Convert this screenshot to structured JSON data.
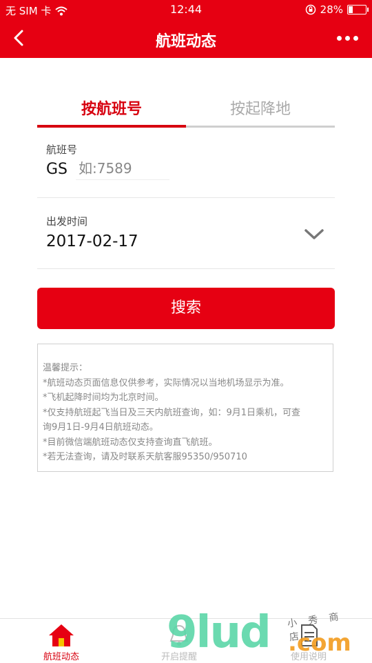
{
  "statusbar": {
    "carrier": "无 SIM 卡",
    "time": "12:44",
    "battery_text": "28%",
    "battery_level": 0.28
  },
  "navbar": {
    "title": "航班动态",
    "back_icon": "chevron-left-icon",
    "more_icon": "more-dots-icon"
  },
  "tabs": [
    {
      "label": "按航班号",
      "active": true
    },
    {
      "label": "按起降地",
      "active": false
    }
  ],
  "flight_field": {
    "label": "航班号",
    "prefix": "GS",
    "placeholder": "如:7589",
    "value": ""
  },
  "date_field": {
    "label": "出发时间",
    "value": "2017-02-17",
    "icon": "chevron-down-icon"
  },
  "search_button": {
    "label": "搜索"
  },
  "tips": {
    "lines": [
      "温馨提示：",
      "*航班动态页面信息仅供参考，实际情况以当地机场显示为准。",
      "*飞机起降时间均为北京时间。",
      "*仅支持航班起飞当日及三天内航班查询，如：9月1日乘机，可查",
      "询9月1日-9月4日航班动态。",
      "*目前微信端航班动态仅支持查询直飞航班。",
      "*若无法查询，请及时联系天航客服95350/950710"
    ]
  },
  "tabbar": {
    "items": [
      {
        "label": "航班动态",
        "icon": "home-icon",
        "active": true
      },
      {
        "label": "开启提醒",
        "icon": "bell-icon",
        "active": false
      },
      {
        "label": "使用说明",
        "icon": "document-icon",
        "active": false
      }
    ]
  },
  "watermark": {
    "brand": "9lud",
    "domain": ".com",
    "handwriting": "小 秀 商 店"
  },
  "colors": {
    "brand_red": "#e60012",
    "tab_active": "#d7000f",
    "tab_inactive": "#aaaaaa",
    "watermark_green": "#5bd6a8",
    "watermark_orange": "#f29c1f"
  }
}
